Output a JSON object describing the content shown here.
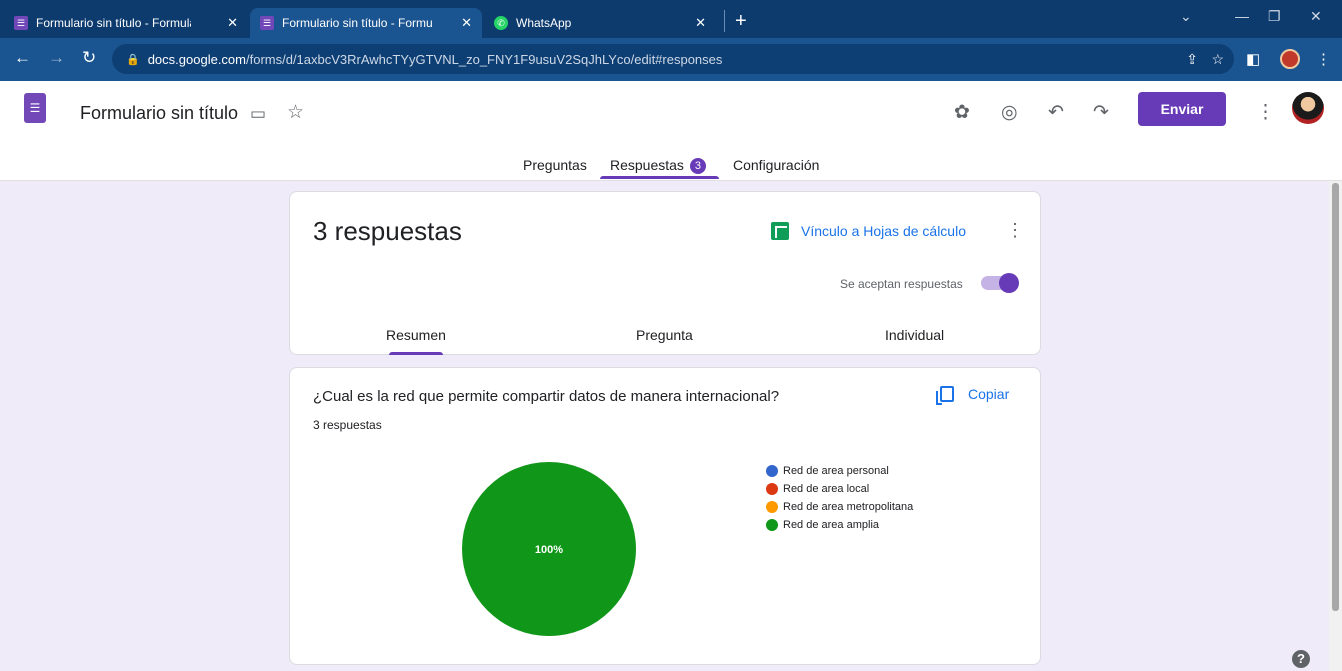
{
  "browser": {
    "tabs": [
      {
        "title": "Formulario sin título - Formulario",
        "active": false,
        "icon": "forms-icon"
      },
      {
        "title": "Formulario sin título - Formulario",
        "active": true,
        "icon": "forms-icon"
      },
      {
        "title": "WhatsApp",
        "active": false,
        "icon": "whatsapp-icon"
      }
    ],
    "tab_close": "✕",
    "new_tab": "+",
    "url_host": "docs.google.com",
    "url_path": "/forms/d/1axbcV3RrAwhcTYyGTVNL_zo_FNY1F9usuV2SqJhLYco/edit#responses"
  },
  "header": {
    "form_title": "Formulario sin título",
    "send_label": "Enviar",
    "tabs": {
      "questions": "Preguntas",
      "responses": "Respuestas",
      "responses_badge": "3",
      "settings": "Configuración"
    }
  },
  "summary_card": {
    "title": "3 respuestas",
    "sheets_link": "Vínculo a Hojas de cálculo",
    "accepting_label": "Se aceptan respuestas",
    "accepting": true,
    "subtabs": {
      "summary": "Resumen",
      "question": "Pregunta",
      "individual": "Individual"
    }
  },
  "question_card": {
    "question": "¿Cual es la red que permite compartir datos de manera internacional?",
    "count": "3 respuestas",
    "copy_label": "Copiar"
  },
  "chart_data": {
    "type": "pie",
    "categories": [
      "Red de area personal",
      "Red de area local",
      "Red de area metropolitana",
      "Red de area amplia"
    ],
    "values": [
      0,
      0,
      0,
      100
    ],
    "labels": [
      "",
      "",
      "",
      "100%"
    ],
    "colors": [
      "#3366cc",
      "#dc3912",
      "#ff9900",
      "#109618"
    ],
    "legend": "right"
  }
}
